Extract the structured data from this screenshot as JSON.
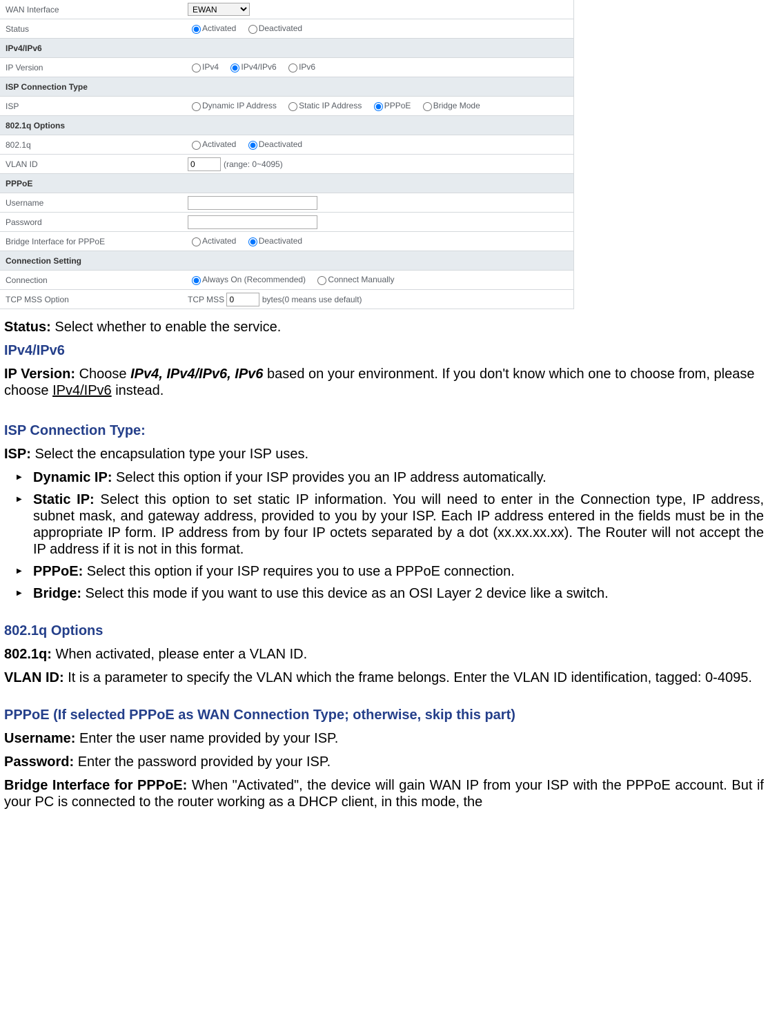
{
  "table": {
    "wan_interface": {
      "label": "WAN Interface",
      "value": "EWAN"
    },
    "status": {
      "label": "Status",
      "opt_activated": "Activated",
      "opt_deactivated": "Deactivated"
    },
    "ipv4ipv6_header": "IPv4/IPv6",
    "ip_version": {
      "label": "IP Version",
      "opt_ipv4": "IPv4",
      "opt_both": "IPv4/IPv6",
      "opt_ipv6": "IPv6"
    },
    "isp_conn_header": "ISP Connection Type",
    "isp": {
      "label": "ISP",
      "opt_dyn": "Dynamic IP Address",
      "opt_static": "Static IP Address",
      "opt_pppoe": "PPPoE",
      "opt_bridge": "Bridge Mode"
    },
    "q_header": "802.1q Options",
    "q": {
      "label": "802.1q",
      "opt_activated": "Activated",
      "opt_deactivated": "Deactivated"
    },
    "vlan": {
      "label": "VLAN ID",
      "value": "0",
      "hint": "(range: 0~4095)"
    },
    "pppoe_header": "PPPoE",
    "username": {
      "label": "Username",
      "value": ""
    },
    "password": {
      "label": "Password",
      "value": ""
    },
    "bridge_pppoe": {
      "label": "Bridge Interface for PPPoE",
      "opt_activated": "Activated",
      "opt_deactivated": "Deactivated"
    },
    "conn_header": "Connection Setting",
    "connection": {
      "label": "Connection",
      "opt_always": "Always On (Recommended)",
      "opt_manual": "Connect Manually"
    },
    "mss": {
      "label": "TCP MSS Option",
      "prefix": "TCP MSS",
      "value": "0",
      "suffix": "bytes(0 means use default)"
    }
  },
  "doc": {
    "status_label": "Status:",
    "status_text": " Select whether to enable the service.",
    "ipv4_title": "IPv4/IPv6",
    "ipver_label": "IP Version:",
    "ipver_text1": " Choose ",
    "ipver_bi": "IPv4, IPv4/IPv6, IPv6",
    "ipver_text2": " based on your environment. If you don't know which one to choose from, please choose ",
    "ipver_u": "IPv4/IPv6",
    "ipver_text3": " instead.",
    "isp_title": "ISP Connection Type:",
    "isp_label": "ISP:",
    "isp_text": " Select the encapsulation type your ISP uses.",
    "b_dyn_label": "Dynamic IP:",
    "b_dyn_text": " Select this option if your ISP provides you an IP address automatically.",
    "b_static_label": "Static IP:",
    "b_static_text": " Select this option to set static IP information. You will need to enter in the Connection type, IP address, subnet mask, and gateway address, provided to you by your ISP. Each IP address entered in the fields must be in the appropriate IP form.  IP address from by four IP octets separated by a dot (xx.xx.xx.xx). The Router will not accept the IP address if it is not in this format.",
    "b_pppoe_label": "PPPoE:",
    "b_pppoe_text": " Select this option if your ISP requires you to use a PPPoE connection.",
    "b_bridge_label": "Bridge:",
    "b_bridge_text": " Select this mode if you want to use this device as an OSI Layer 2 device like a switch.",
    "q_title": "802.1q Options",
    "q_label": "802.1q:",
    "q_text": " When activated, please enter a VLAN ID.",
    "vlan_label": "VLAN ID:",
    "vlan_text": " It is a parameter to specify the VLAN which the frame belongs. Enter the VLAN ID identification, tagged: 0-4095.",
    "pppoe_title": "PPPoE (If selected PPPoE as WAN Connection Type; otherwise, skip this part)",
    "user_label": "Username:",
    "user_text": " Enter the user name provided by your ISP.",
    "pass_label": "Password:",
    "pass_text": " Enter the password provided by your ISP.",
    "bif_label": "Bridge Interface for PPPoE:",
    "bif_text": " When \"Activated\", the device will gain WAN IP from your ISP with the PPPoE account. But if your PC is connected to the router working as a DHCP client, in this mode, the"
  }
}
